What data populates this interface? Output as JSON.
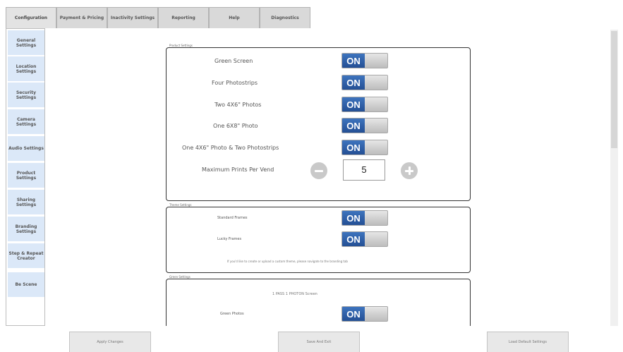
{
  "tabs": [
    {
      "label": "Configuration"
    },
    {
      "label": "Payment & Pricing"
    },
    {
      "label": "Inactivity Settings"
    },
    {
      "label": "Reporting"
    },
    {
      "label": "Help"
    },
    {
      "label": "Diagnostics"
    }
  ],
  "active_tab": "Configuration",
  "sidebar": {
    "items": [
      {
        "label": "General Settings"
      },
      {
        "label": "Location Settings"
      },
      {
        "label": "Security Settings"
      },
      {
        "label": "Camera Settings"
      },
      {
        "label": "Audio Settings"
      },
      {
        "label": "Product Settings"
      },
      {
        "label": "Sharing Settings"
      },
      {
        "label": "Branding Settings"
      },
      {
        "label": "Step & Repeat Creator"
      },
      {
        "label": "Be Scene"
      }
    ]
  },
  "product_settings": {
    "legend": "Product Settings",
    "rows": [
      {
        "label": "Green Screen",
        "value": "ON"
      },
      {
        "label": "Four Photostrips",
        "value": "ON"
      },
      {
        "label": "Two 4X6\" Photos",
        "value": "ON"
      },
      {
        "label": "One 6X8\" Photo",
        "value": "ON"
      },
      {
        "label": "One 4X6\" Photo & Two Photostrips",
        "value": "ON"
      }
    ],
    "max_prints": {
      "label": "Maximum Prints Per Vend",
      "value": "5"
    }
  },
  "theme_settings": {
    "legend": "Theme Settings",
    "rows": [
      {
        "label": "Standard Frames",
        "value": "ON"
      },
      {
        "label": "Lucky Frames",
        "value": "ON"
      }
    ],
    "note": "If you'd like to create or upload a custom theme, please navigate to the branding tab"
  },
  "green_settings": {
    "legend": "Green Settings",
    "subtitle": "1 PASS 1 PHOTON Screen",
    "rows": [
      {
        "label": "Green Photos",
        "value": "ON"
      }
    ]
  },
  "bottom_buttons": {
    "apply": "Apply Changes",
    "save": "Save And Exit",
    "defaults": "Load Default Settings"
  }
}
